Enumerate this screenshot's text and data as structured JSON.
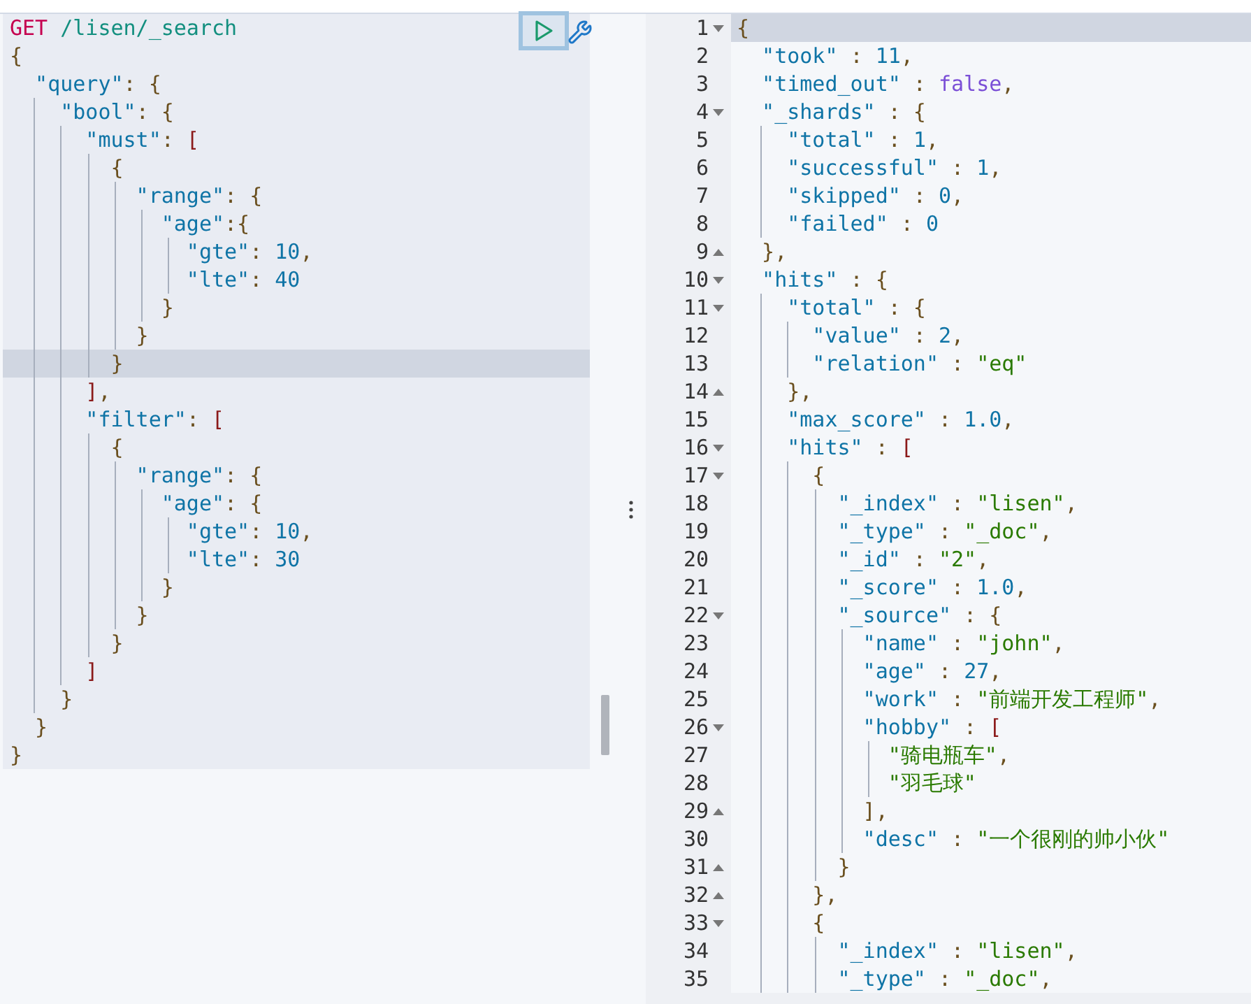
{
  "request": {
    "lines": [
      {
        "active": false,
        "tokens": [
          {
            "kind": "method",
            "text": "GET"
          },
          {
            "kind": "url",
            "text": " /lisen/_search"
          }
        ]
      },
      {
        "active": false,
        "tokens": [
          {
            "kind": "punct",
            "text": "{"
          }
        ]
      },
      {
        "active": false,
        "tokens": [
          {
            "kind": "key",
            "text": "  \"query\""
          },
          {
            "kind": "punct",
            "text": ": {"
          }
        ]
      },
      {
        "active": false,
        "tokens": [
          {
            "kind": "key",
            "text": "    \"bool\""
          },
          {
            "kind": "punct",
            "text": ": {"
          }
        ]
      },
      {
        "active": false,
        "tokens": [
          {
            "kind": "key",
            "text": "      \"must\""
          },
          {
            "kind": "punct",
            "text": ": "
          },
          {
            "kind": "bracket",
            "text": "["
          }
        ]
      },
      {
        "active": false,
        "tokens": [
          {
            "kind": "punct",
            "text": "        {"
          }
        ]
      },
      {
        "active": false,
        "tokens": [
          {
            "kind": "key",
            "text": "          \"range\""
          },
          {
            "kind": "punct",
            "text": ": {"
          }
        ]
      },
      {
        "active": false,
        "tokens": [
          {
            "kind": "key",
            "text": "            \"age\""
          },
          {
            "kind": "punct",
            "text": ":{"
          }
        ]
      },
      {
        "active": false,
        "tokens": [
          {
            "kind": "key",
            "text": "              \"gte\""
          },
          {
            "kind": "punct",
            "text": ": "
          },
          {
            "kind": "num",
            "text": "10"
          },
          {
            "kind": "punct",
            "text": ","
          }
        ]
      },
      {
        "active": false,
        "tokens": [
          {
            "kind": "key",
            "text": "              \"lte\""
          },
          {
            "kind": "punct",
            "text": ": "
          },
          {
            "kind": "num",
            "text": "40"
          }
        ]
      },
      {
        "active": false,
        "tokens": [
          {
            "kind": "punct",
            "text": "            }"
          }
        ]
      },
      {
        "active": false,
        "tokens": [
          {
            "kind": "punct",
            "text": "          }"
          }
        ]
      },
      {
        "active": true,
        "tokens": [
          {
            "kind": "punct",
            "text": "        }"
          }
        ]
      },
      {
        "active": false,
        "tokens": [
          {
            "kind": "bracket",
            "text": "      ]"
          },
          {
            "kind": "punct",
            "text": ","
          }
        ]
      },
      {
        "active": false,
        "tokens": [
          {
            "kind": "key",
            "text": "      \"filter\""
          },
          {
            "kind": "punct",
            "text": ": "
          },
          {
            "kind": "bracket",
            "text": "["
          }
        ]
      },
      {
        "active": false,
        "tokens": [
          {
            "kind": "punct",
            "text": "        {"
          }
        ]
      },
      {
        "active": false,
        "tokens": [
          {
            "kind": "key",
            "text": "          \"range\""
          },
          {
            "kind": "punct",
            "text": ": {"
          }
        ]
      },
      {
        "active": false,
        "tokens": [
          {
            "kind": "key",
            "text": "            \"age\""
          },
          {
            "kind": "punct",
            "text": ": {"
          }
        ]
      },
      {
        "active": false,
        "tokens": [
          {
            "kind": "key",
            "text": "              \"gte\""
          },
          {
            "kind": "punct",
            "text": ": "
          },
          {
            "kind": "num",
            "text": "10"
          },
          {
            "kind": "punct",
            "text": ","
          }
        ]
      },
      {
        "active": false,
        "tokens": [
          {
            "kind": "key",
            "text": "              \"lte\""
          },
          {
            "kind": "punct",
            "text": ": "
          },
          {
            "kind": "num",
            "text": "30"
          }
        ]
      },
      {
        "active": false,
        "tokens": [
          {
            "kind": "punct",
            "text": "            }"
          }
        ]
      },
      {
        "active": false,
        "tokens": [
          {
            "kind": "punct",
            "text": "          }"
          }
        ]
      },
      {
        "active": false,
        "tokens": [
          {
            "kind": "punct",
            "text": "        }"
          }
        ]
      },
      {
        "active": false,
        "tokens": [
          {
            "kind": "bracket",
            "text": "      ]"
          }
        ]
      },
      {
        "active": false,
        "tokens": [
          {
            "kind": "punct",
            "text": "    }"
          }
        ]
      },
      {
        "active": false,
        "tokens": [
          {
            "kind": "punct",
            "text": "  }"
          }
        ]
      },
      {
        "active": false,
        "tokens": [
          {
            "kind": "punct",
            "text": "}"
          }
        ]
      }
    ]
  },
  "response": {
    "lines": [
      {
        "number": "1",
        "kind": "open",
        "active": true,
        "tokens": [
          {
            "kind": "punct",
            "text": "{"
          }
        ]
      },
      {
        "number": "2",
        "active": false,
        "tokens": [
          {
            "kind": "key",
            "text": "  \"took\""
          },
          {
            "kind": "punct",
            "text": " : "
          },
          {
            "kind": "num",
            "text": "11"
          },
          {
            "kind": "punct",
            "text": ","
          }
        ]
      },
      {
        "number": "3",
        "active": false,
        "tokens": [
          {
            "kind": "key",
            "text": "  \"timed_out\""
          },
          {
            "kind": "punct",
            "text": " : "
          },
          {
            "kind": "bool",
            "text": "false"
          },
          {
            "kind": "punct",
            "text": ","
          }
        ]
      },
      {
        "number": "4",
        "kind": "open",
        "active": false,
        "tokens": [
          {
            "kind": "key",
            "text": "  \"_shards\""
          },
          {
            "kind": "punct",
            "text": " : {"
          }
        ]
      },
      {
        "number": "5",
        "active": false,
        "tokens": [
          {
            "kind": "key",
            "text": "    \"total\""
          },
          {
            "kind": "punct",
            "text": " : "
          },
          {
            "kind": "num",
            "text": "1"
          },
          {
            "kind": "punct",
            "text": ","
          }
        ]
      },
      {
        "number": "6",
        "active": false,
        "tokens": [
          {
            "kind": "key",
            "text": "    \"successful\""
          },
          {
            "kind": "punct",
            "text": " : "
          },
          {
            "kind": "num",
            "text": "1"
          },
          {
            "kind": "punct",
            "text": ","
          }
        ]
      },
      {
        "number": "7",
        "active": false,
        "tokens": [
          {
            "kind": "key",
            "text": "    \"skipped\""
          },
          {
            "kind": "punct",
            "text": " : "
          },
          {
            "kind": "num",
            "text": "0"
          },
          {
            "kind": "punct",
            "text": ","
          }
        ]
      },
      {
        "number": "8",
        "active": false,
        "tokens": [
          {
            "kind": "key",
            "text": "    \"failed\""
          },
          {
            "kind": "punct",
            "text": " : "
          },
          {
            "kind": "num",
            "text": "0"
          }
        ]
      },
      {
        "number": "9",
        "kind": "close",
        "active": false,
        "tokens": [
          {
            "kind": "punct",
            "text": "  },"
          }
        ]
      },
      {
        "number": "10",
        "kind": "open",
        "active": false,
        "tokens": [
          {
            "kind": "key",
            "text": "  \"hits\""
          },
          {
            "kind": "punct",
            "text": " : {"
          }
        ]
      },
      {
        "number": "11",
        "kind": "open",
        "active": false,
        "tokens": [
          {
            "kind": "key",
            "text": "    \"total\""
          },
          {
            "kind": "punct",
            "text": " : {"
          }
        ]
      },
      {
        "number": "12",
        "active": false,
        "tokens": [
          {
            "kind": "key",
            "text": "      \"value\""
          },
          {
            "kind": "punct",
            "text": " : "
          },
          {
            "kind": "num",
            "text": "2"
          },
          {
            "kind": "punct",
            "text": ","
          }
        ]
      },
      {
        "number": "13",
        "active": false,
        "tokens": [
          {
            "kind": "key",
            "text": "      \"relation\""
          },
          {
            "kind": "punct",
            "text": " : "
          },
          {
            "kind": "str",
            "text": "\"eq\""
          }
        ]
      },
      {
        "number": "14",
        "kind": "close",
        "active": false,
        "tokens": [
          {
            "kind": "punct",
            "text": "    },"
          }
        ]
      },
      {
        "number": "15",
        "active": false,
        "tokens": [
          {
            "kind": "key",
            "text": "    \"max_score\""
          },
          {
            "kind": "punct",
            "text": " : "
          },
          {
            "kind": "num",
            "text": "1.0"
          },
          {
            "kind": "punct",
            "text": ","
          }
        ]
      },
      {
        "number": "16",
        "kind": "open",
        "active": false,
        "tokens": [
          {
            "kind": "key",
            "text": "    \"hits\""
          },
          {
            "kind": "punct",
            "text": " : "
          },
          {
            "kind": "bracket",
            "text": "["
          }
        ]
      },
      {
        "number": "17",
        "kind": "open",
        "active": false,
        "tokens": [
          {
            "kind": "punct",
            "text": "      {"
          }
        ]
      },
      {
        "number": "18",
        "active": false,
        "tokens": [
          {
            "kind": "key",
            "text": "        \"_index\""
          },
          {
            "kind": "punct",
            "text": " : "
          },
          {
            "kind": "str",
            "text": "\"lisen\""
          },
          {
            "kind": "punct",
            "text": ","
          }
        ]
      },
      {
        "number": "19",
        "active": false,
        "tokens": [
          {
            "kind": "key",
            "text": "        \"_type\""
          },
          {
            "kind": "punct",
            "text": " : "
          },
          {
            "kind": "str",
            "text": "\"_doc\""
          },
          {
            "kind": "punct",
            "text": ","
          }
        ]
      },
      {
        "number": "20",
        "active": false,
        "tokens": [
          {
            "kind": "key",
            "text": "        \"_id\""
          },
          {
            "kind": "punct",
            "text": " : "
          },
          {
            "kind": "str",
            "text": "\"2\""
          },
          {
            "kind": "punct",
            "text": ","
          }
        ]
      },
      {
        "number": "21",
        "active": false,
        "tokens": [
          {
            "kind": "key",
            "text": "        \"_score\""
          },
          {
            "kind": "punct",
            "text": " : "
          },
          {
            "kind": "num",
            "text": "1.0"
          },
          {
            "kind": "punct",
            "text": ","
          }
        ]
      },
      {
        "number": "22",
        "kind": "open",
        "active": false,
        "tokens": [
          {
            "kind": "key",
            "text": "        \"_source\""
          },
          {
            "kind": "punct",
            "text": " : {"
          }
        ]
      },
      {
        "number": "23",
        "active": false,
        "tokens": [
          {
            "kind": "key",
            "text": "          \"name\""
          },
          {
            "kind": "punct",
            "text": " : "
          },
          {
            "kind": "str",
            "text": "\"john\""
          },
          {
            "kind": "punct",
            "text": ","
          }
        ]
      },
      {
        "number": "24",
        "active": false,
        "tokens": [
          {
            "kind": "key",
            "text": "          \"age\""
          },
          {
            "kind": "punct",
            "text": " : "
          },
          {
            "kind": "num",
            "text": "27"
          },
          {
            "kind": "punct",
            "text": ","
          }
        ]
      },
      {
        "number": "25",
        "active": false,
        "tokens": [
          {
            "kind": "key",
            "text": "          \"work\""
          },
          {
            "kind": "punct",
            "text": " : "
          },
          {
            "kind": "str",
            "text": "\"前端开发工程师\""
          },
          {
            "kind": "punct",
            "text": ","
          }
        ]
      },
      {
        "number": "26",
        "kind": "open",
        "active": false,
        "tokens": [
          {
            "kind": "key",
            "text": "          \"hobby\""
          },
          {
            "kind": "punct",
            "text": " : "
          },
          {
            "kind": "bracket",
            "text": "["
          }
        ]
      },
      {
        "number": "27",
        "active": false,
        "tokens": [
          {
            "kind": "str",
            "text": "            \"骑电瓶车\""
          },
          {
            "kind": "punct",
            "text": ","
          }
        ]
      },
      {
        "number": "28",
        "active": false,
        "tokens": [
          {
            "kind": "str",
            "text": "            \"羽毛球\""
          }
        ]
      },
      {
        "number": "29",
        "kind": "close",
        "active": false,
        "tokens": [
          {
            "kind": "punct",
            "text": "          ],"
          }
        ]
      },
      {
        "number": "30",
        "active": false,
        "tokens": [
          {
            "kind": "key",
            "text": "          \"desc\""
          },
          {
            "kind": "punct",
            "text": " : "
          },
          {
            "kind": "str",
            "text": "\"一个很刚的帅小伙\""
          }
        ]
      },
      {
        "number": "31",
        "kind": "close",
        "active": false,
        "tokens": [
          {
            "kind": "punct",
            "text": "        }"
          }
        ]
      },
      {
        "number": "32",
        "kind": "close",
        "active": false,
        "tokens": [
          {
            "kind": "punct",
            "text": "      },"
          }
        ]
      },
      {
        "number": "33",
        "kind": "open",
        "active": false,
        "tokens": [
          {
            "kind": "punct",
            "text": "      {"
          }
        ]
      },
      {
        "number": "34",
        "active": false,
        "tokens": [
          {
            "kind": "key",
            "text": "        \"_index\""
          },
          {
            "kind": "punct",
            "text": " : "
          },
          {
            "kind": "str",
            "text": "\"lisen\""
          },
          {
            "kind": "punct",
            "text": ","
          }
        ]
      },
      {
        "number": "35",
        "active": false,
        "tokens": [
          {
            "kind": "key",
            "text": "        \"_type\""
          },
          {
            "kind": "punct",
            "text": " : "
          },
          {
            "kind": "str",
            "text": "\"_doc\""
          },
          {
            "kind": "punct",
            "text": ","
          }
        ]
      }
    ]
  }
}
